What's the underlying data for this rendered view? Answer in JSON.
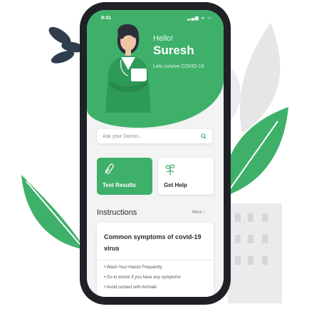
{
  "status": {
    "time": "9:41",
    "icons": "▂▄▆ ᯤ ▭"
  },
  "greeting": {
    "hello": "Hello!",
    "name": "Suresh",
    "subtitle": "Lets survive COVID-19"
  },
  "search": {
    "placeholder": "Ask your Doctor..."
  },
  "cards": [
    {
      "label": "Test Results",
      "icon": "test-tube-icon"
    },
    {
      "label": "Get Help",
      "icon": "help-plant-icon"
    }
  ],
  "instructions": {
    "title": "Instructions",
    "more": "More ›"
  },
  "panel": {
    "title": "Common symptoms of covid-19 virus",
    "items": [
      "Wash Your Hands Frequently",
      "Go to doctor if you have any symptoms",
      "Avoid contact with Animals"
    ]
  },
  "colors": {
    "accent": "#3fb06a",
    "phone": "#1f2126",
    "screen": "#f2f3f3"
  }
}
